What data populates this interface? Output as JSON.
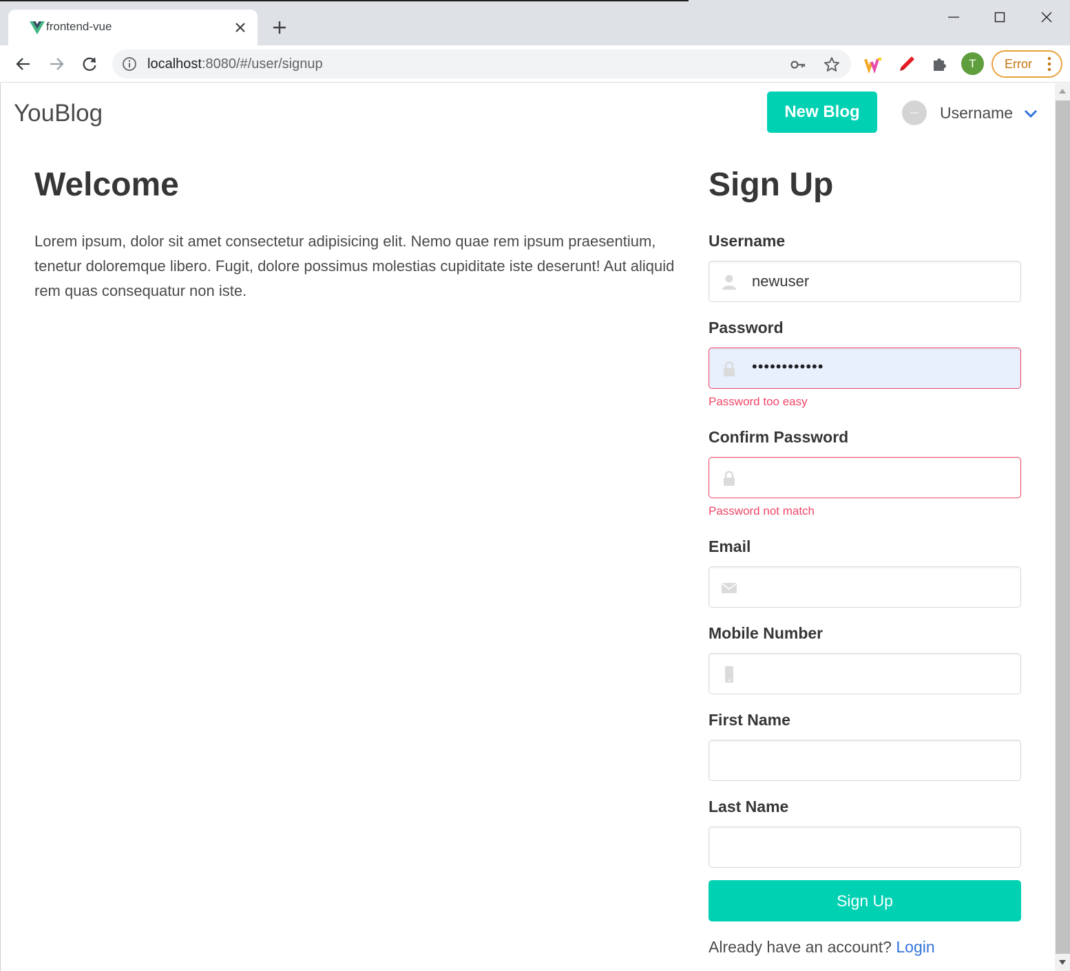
{
  "browser": {
    "tab_title": "frontend-vue",
    "url_host": "localhost",
    "url_rest": ":8080/#/user/signup",
    "profile_initial": "T",
    "error_label": "Error"
  },
  "navbar": {
    "brand": "YouBlog",
    "new_blog_label": "New Blog",
    "username_label": "Username"
  },
  "welcome": {
    "title": "Welcome",
    "text": "Lorem ipsum, dolor sit amet consectetur adipisicing elit. Nemo quae rem ipsum praesentium, tenetur doloremque libero. Fugit, dolore possimus molestias cupiditate iste deserunt! Aut aliquid rem quas consequatur non iste."
  },
  "signup": {
    "title": "Sign Up",
    "fields": {
      "username": {
        "label": "Username",
        "value": "newuser",
        "icon": "user-icon"
      },
      "password": {
        "label": "Password",
        "value": "••••••••••••",
        "icon": "lock-icon",
        "error": "Password too easy"
      },
      "confirm_password": {
        "label": "Confirm Password",
        "value": "",
        "icon": "lock-icon",
        "error": "Password not match"
      },
      "email": {
        "label": "Email",
        "value": "",
        "icon": "envelope-icon"
      },
      "mobile": {
        "label": "Mobile Number",
        "value": "",
        "icon": "mobile-icon"
      },
      "first_name": {
        "label": "First Name",
        "value": ""
      },
      "last_name": {
        "label": "Last Name",
        "value": ""
      }
    },
    "submit_label": "Sign Up",
    "already_text": "Already have an account?",
    "login_link": "Login"
  },
  "colors": {
    "primary": "#00d1b2",
    "danger": "#f14668",
    "link": "#3273dc",
    "autofill": "#e8f0fe"
  }
}
